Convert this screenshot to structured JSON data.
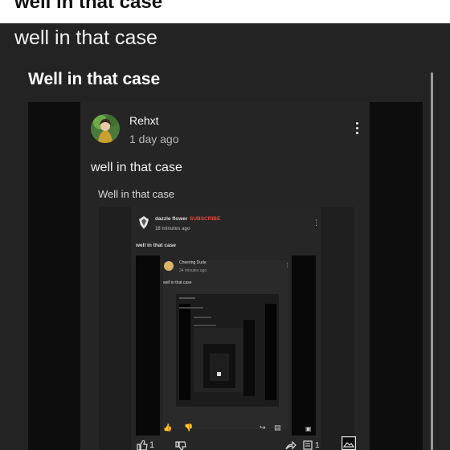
{
  "header": {
    "title": "well in that case"
  },
  "post": {
    "title": "well in that case"
  },
  "card": {
    "title": "Well in that case"
  },
  "comment": {
    "author": "Rehxt",
    "time": "1 day ago",
    "text": "well in that case",
    "quoted_title": "Well in that case"
  },
  "nested1": {
    "author": "dazzle flower",
    "subscribe": "SUBSCRIBE",
    "time": "18 minutes ago",
    "text": "well in that case"
  },
  "nested2": {
    "author": "Cheering Dude",
    "time": "34 minutes ago",
    "text": "well in that case"
  },
  "reactions": {
    "like_count": "1",
    "comment_count": "1"
  }
}
